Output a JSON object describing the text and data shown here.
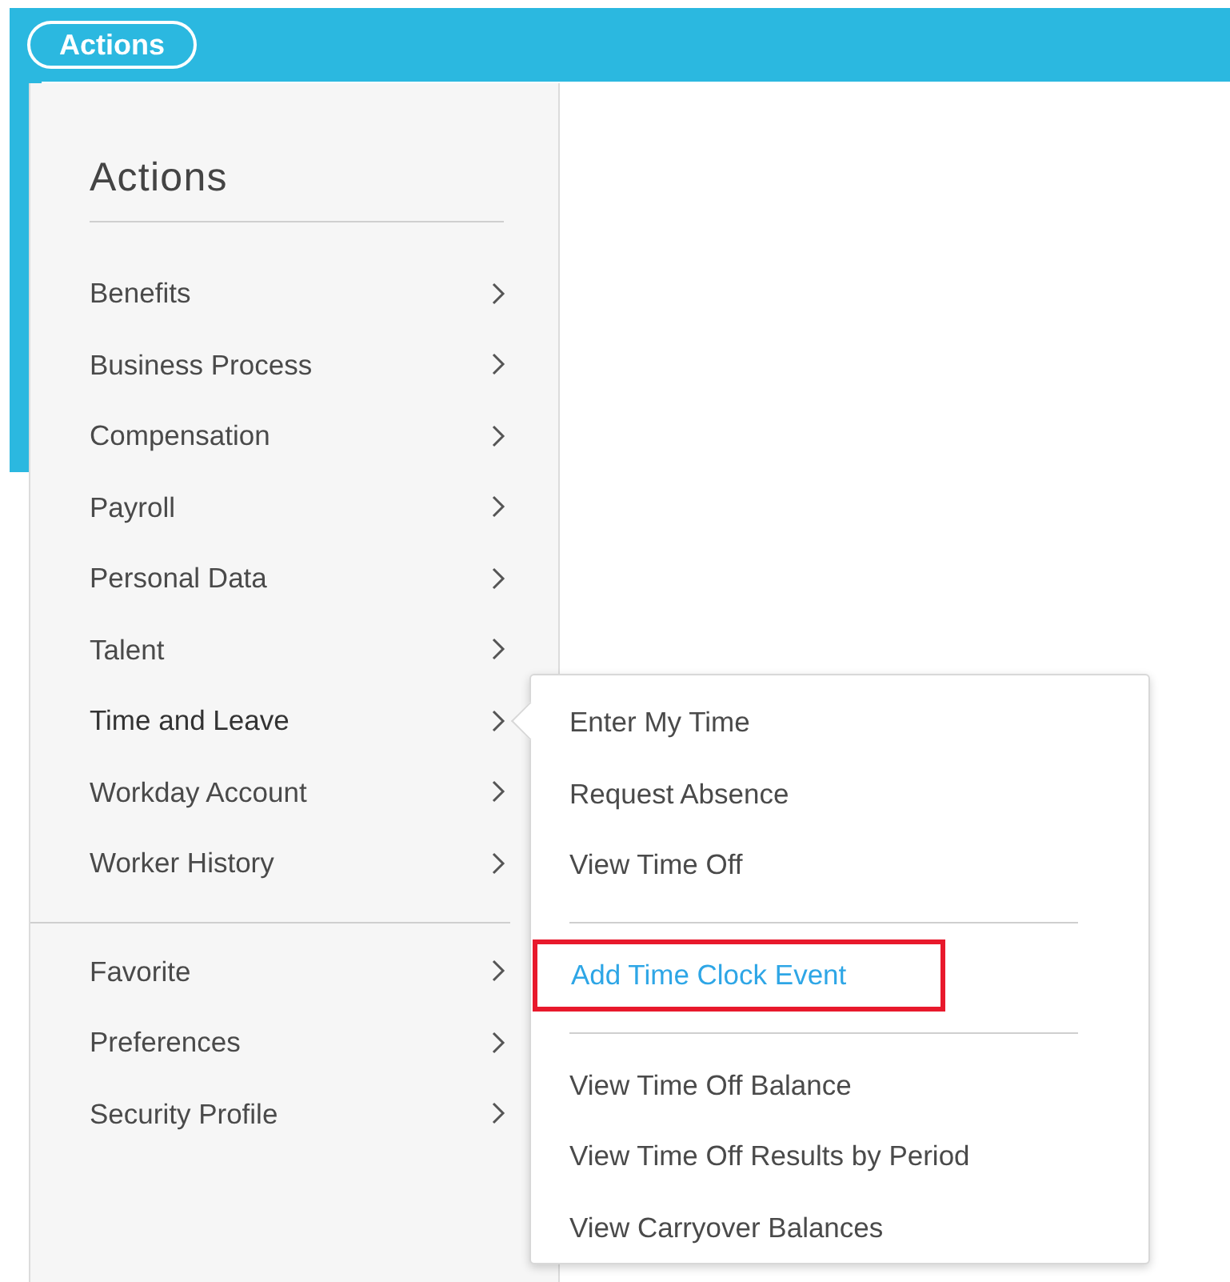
{
  "header": {
    "actions_button": "Actions"
  },
  "menu": {
    "title": "Actions",
    "groups": [
      {
        "items": [
          {
            "label": "Benefits",
            "expanded": false
          },
          {
            "label": "Business Process",
            "expanded": false
          },
          {
            "label": "Compensation",
            "expanded": false
          },
          {
            "label": "Payroll",
            "expanded": false
          },
          {
            "label": "Personal Data",
            "expanded": false
          },
          {
            "label": "Talent",
            "expanded": false
          },
          {
            "label": "Time and Leave",
            "expanded": true,
            "submenu": [
              {
                "items": [
                  {
                    "label": "Enter My Time",
                    "highlighted": false
                  },
                  {
                    "label": "Request Absence",
                    "highlighted": false
                  },
                  {
                    "label": "View Time Off",
                    "highlighted": false
                  }
                ]
              },
              {
                "items": [
                  {
                    "label": "Add Time Clock Event",
                    "highlighted": true
                  }
                ]
              },
              {
                "items": [
                  {
                    "label": "View Time Off Balance",
                    "highlighted": false
                  },
                  {
                    "label": "View Time Off Results by Period",
                    "highlighted": false
                  },
                  {
                    "label": "View Carryover Balances",
                    "highlighted": false
                  }
                ]
              }
            ]
          },
          {
            "label": "Workday Account",
            "expanded": false
          },
          {
            "label": "Worker History",
            "expanded": false
          }
        ]
      },
      {
        "items": [
          {
            "label": "Favorite",
            "expanded": false
          },
          {
            "label": "Preferences",
            "expanded": false
          },
          {
            "label": "Security Profile",
            "expanded": false
          }
        ]
      }
    ]
  }
}
